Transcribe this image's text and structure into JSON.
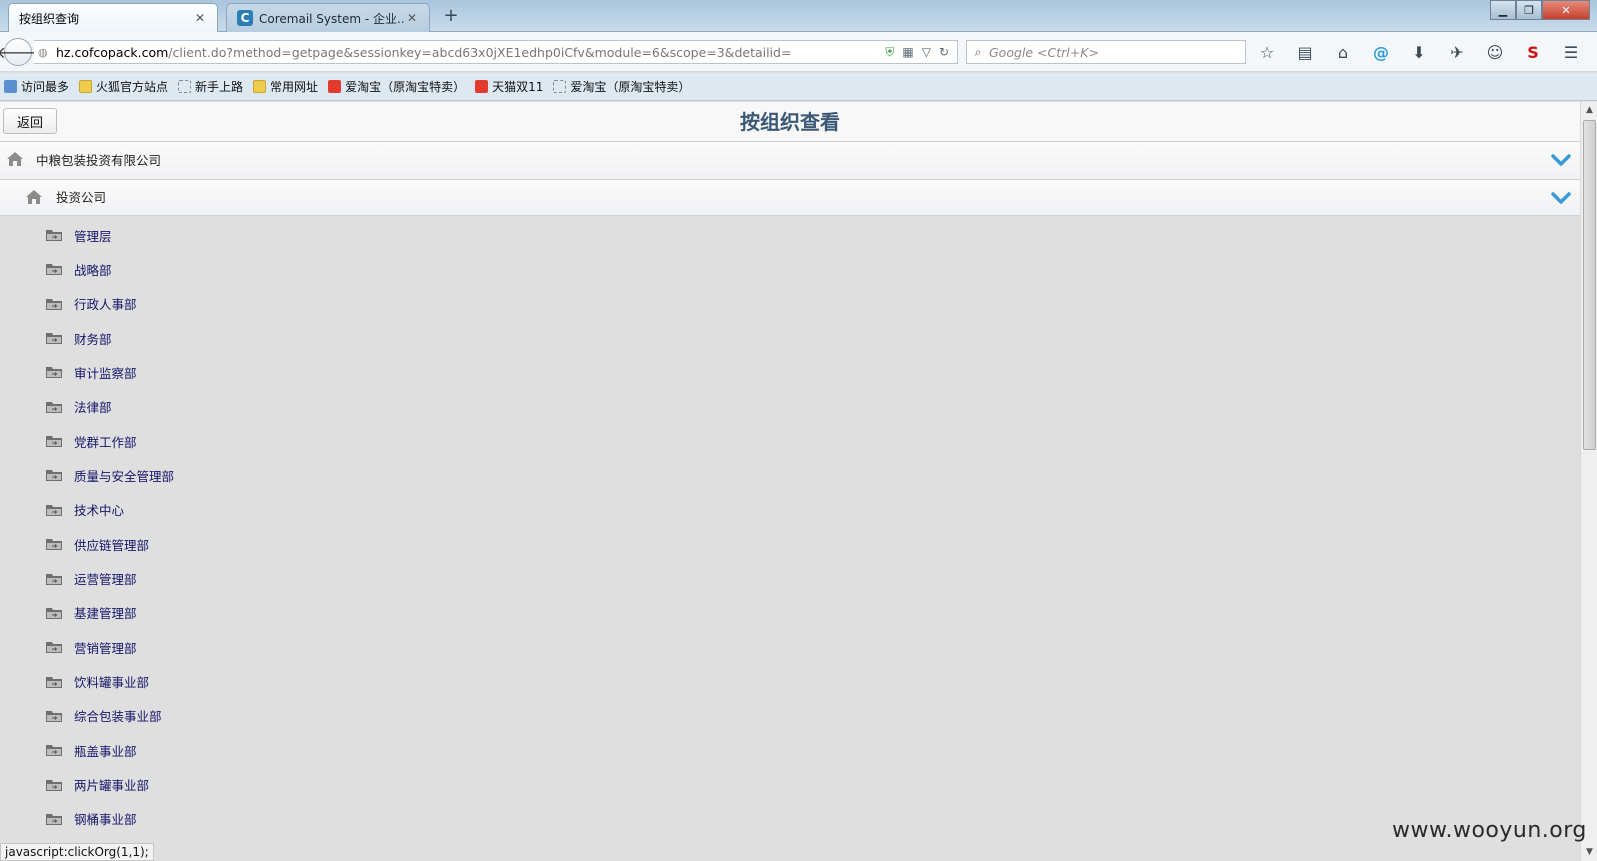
{
  "browser": {
    "tabs": [
      {
        "label": "按组织查询",
        "active": true
      },
      {
        "label": "Coremail System - 企业...",
        "active": false,
        "favicon_letter": "C"
      }
    ],
    "new_tab": "+",
    "url_host": "hz.cofcopack.com",
    "url_path": "/client.do?method=getpage&sessionkey=abcd63x0jXE1edhp0iCfv&module=6&scope=3&detailid=",
    "search_placeholder": "Google <Ctrl+K>",
    "bookmarks": [
      "访问最多",
      "火狐官方站点",
      "新手上路",
      "常用网址",
      "爱淘宝（原淘宝特卖）",
      "天猫双11",
      "爱淘宝（原淘宝特卖）"
    ],
    "status_text": "javascript:clickOrg(1,1);"
  },
  "page": {
    "return_label": "返回",
    "title": "按组织查看",
    "root_org": "中粮包装投资有限公司",
    "sub_org": "投资公司",
    "departments": [
      "管理层",
      "战略部",
      "行政人事部",
      "财务部",
      "审计监察部",
      "法律部",
      "党群工作部",
      "质量与安全管理部",
      "技术中心",
      "供应链管理部",
      "运营管理部",
      "基建管理部",
      "营销管理部",
      "饮料罐事业部",
      "综合包装事业部",
      "瓶盖事业部",
      "两片罐事业部",
      "钢桶事业部"
    ]
  },
  "watermark": "www.wooyun.org",
  "colors": {
    "title": "#3a5873",
    "dept_link": "#16166b",
    "chevron": "#3a9ad9"
  }
}
